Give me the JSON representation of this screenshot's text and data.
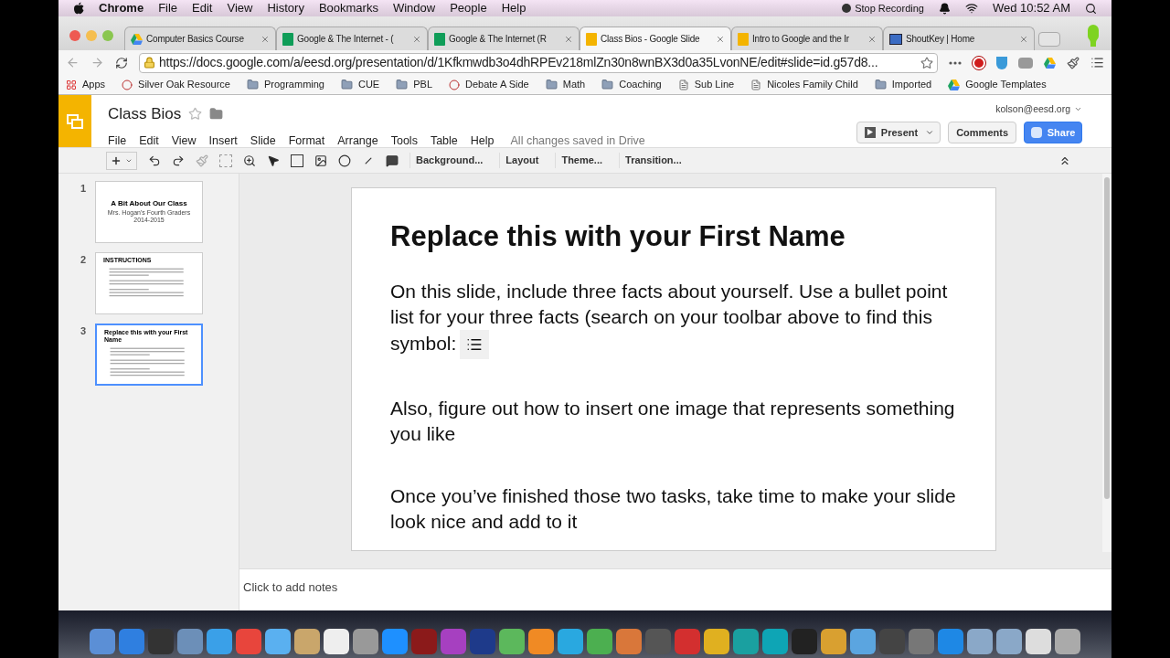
{
  "menubar": {
    "app": "Chrome",
    "menus": [
      "File",
      "Edit",
      "View",
      "History",
      "Bookmarks",
      "Window",
      "People",
      "Help"
    ],
    "recording": "Stop Recording",
    "clock": "Wed 10:52 AM"
  },
  "tabs": [
    {
      "label": "Computer Basics Course",
      "selected": false,
      "kind": "drive"
    },
    {
      "label": "Google & The Internet - (",
      "selected": false,
      "kind": "sheet"
    },
    {
      "label": "Google & The Internet (R",
      "selected": false,
      "kind": "sheet"
    },
    {
      "label": "Class Bios - Google Slide",
      "selected": true,
      "kind": "slides"
    },
    {
      "label": "Intro to Google and the Ir",
      "selected": false,
      "kind": "slides"
    },
    {
      "label": "ShoutKey | Home",
      "selected": false,
      "kind": "monitor"
    }
  ],
  "address": "https://docs.google.com/a/eesd.org/presentation/d/1Kfkmwdb3o4dhRPEv218mlZn30n8wnBX3d0a35LvonNE/edit#slide=id.g57d8...",
  "bookmarks": [
    {
      "label": "Apps",
      "kind": "apps"
    },
    {
      "label": "Silver Oak Resource",
      "kind": "site"
    },
    {
      "label": "Programming",
      "kind": "folder"
    },
    {
      "label": "CUE",
      "kind": "folder"
    },
    {
      "label": "PBL",
      "kind": "folder"
    },
    {
      "label": "Debate A Side",
      "kind": "site"
    },
    {
      "label": "Math",
      "kind": "folder"
    },
    {
      "label": "Coaching",
      "kind": "folder"
    },
    {
      "label": "Sub Line",
      "kind": "page"
    },
    {
      "label": "Nicoles Family Child",
      "kind": "page"
    },
    {
      "label": "Imported",
      "kind": "folder"
    },
    {
      "label": "Google Templates",
      "kind": "drive"
    }
  ],
  "doc": {
    "title": "Class Bios",
    "starred": false,
    "menus": [
      "File",
      "Edit",
      "View",
      "Insert",
      "Slide",
      "Format",
      "Arrange",
      "Tools",
      "Table",
      "Help"
    ],
    "save_status": "All changes saved in Drive",
    "account": "kolson@eesd.org",
    "present": "Present",
    "comments": "Comments",
    "share": "Share"
  },
  "toolbar": [
    "Background...",
    "Layout",
    "Theme...",
    "Transition..."
  ],
  "slides": [
    {
      "number": "1",
      "selected": false,
      "kind": "title",
      "title": "A Bit About Our Class",
      "lines": [
        "Mrs. Hogan's Fourth Graders",
        "2014-2015"
      ]
    },
    {
      "number": "2",
      "selected": false,
      "kind": "list",
      "title": "INSTRUCTIONS"
    },
    {
      "number": "3",
      "selected": true,
      "kind": "list",
      "title": "Replace this with your First Name"
    }
  ],
  "slide": {
    "title": "Replace this with your First Name",
    "paragraphs": [
      "On this slide, include three facts about yourself. Use a bullet point list for your three facts (search on your toolbar above to find this symbol:",
      "Also, figure out how to insert one image that represents something you like",
      "Once you’ve finished those two tasks, take time to make your slide look nice and add to it"
    ]
  },
  "notes": {
    "placeholder": "Click to add notes"
  }
}
